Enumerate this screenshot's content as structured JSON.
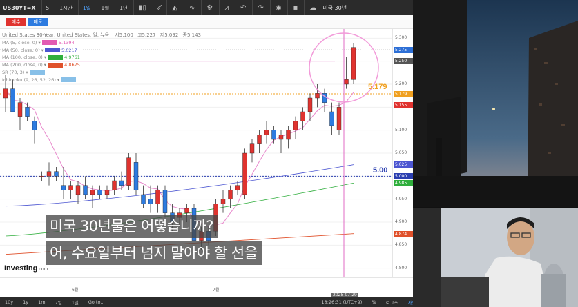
{
  "toolbar": {
    "symbol": "US30YT=X",
    "intervals": [
      "5",
      "1시간",
      "1일",
      "1월",
      "1년"
    ],
    "active_interval": "1일",
    "right_label": "미국 30년"
  },
  "trade": {
    "sell": "매수",
    "buy": "매도"
  },
  "chart_title": "United States 30-Year, United States, 일, 뉴욕",
  "ohlc": {
    "open": "시5.100",
    "high": "고5.227",
    "low": "저5.092",
    "close": "종5.143"
  },
  "indicators": [
    {
      "label": "MA (5, close, 0)",
      "value": "5.1394",
      "color": "#e25ab3"
    },
    {
      "label": "MA (50, close, 0)",
      "value": "5.0217",
      "color": "#4b55d1"
    },
    {
      "label": "MA (100, close, 0)",
      "value": "4.9761",
      "color": "#2fae3c"
    },
    {
      "label": "MA (200, close, 0)",
      "value": "4.8675",
      "color": "#e0502a"
    },
    {
      "label": "SR (70, 3)",
      "value": "",
      "color": "#88c0e8"
    },
    {
      "label": "Ichimoku (9, 26, 52, 26)",
      "value": "",
      "color": "#88c0e8"
    }
  ],
  "price_axis": [
    "5.300",
    "5.250",
    "5.200",
    "5.150",
    "5.100",
    "5.050",
    "5.000",
    "4.950",
    "4.900",
    "4.850",
    "4.800"
  ],
  "price_tags": [
    {
      "text": "5.275",
      "color": "#2d6fd6",
      "price": 5.275
    },
    {
      "text": "5.250",
      "color": "#555555",
      "price": 5.25
    },
    {
      "text": "5.179",
      "color": "#f0a020",
      "price": 5.179
    },
    {
      "text": "5.155",
      "color": "#e0332f",
      "price": 5.155
    },
    {
      "text": "5.025",
      "color": "#4b55d1",
      "price": 5.025
    },
    {
      "text": "5.000",
      "color": "#2b3fb0",
      "price": 5.0
    },
    {
      "text": "4.985",
      "color": "#2fae3c",
      "price": 4.985
    },
    {
      "text": "4.874",
      "color": "#e0502a",
      "price": 4.874
    }
  ],
  "annotations": {
    "orange_level": "5.179",
    "blue_level": "5.00"
  },
  "time_axis": {
    "month1": "6월",
    "month2": "7월",
    "cursor_date": "2025-07-29"
  },
  "bottombar": [
    "10y",
    "1y",
    "1m",
    "7일",
    "1일",
    "Go to...",
    "18:26:31 (UTC+9)",
    "%",
    "로그스",
    "자동"
  ],
  "logo": {
    "name": "Investing",
    "suffix": ".com"
  },
  "subtitles": {
    "line1": "미국 30년물은 어떻습니까?",
    "line2": "어, 수요일부터 넘지 말아야 할 선을"
  },
  "chart_data": {
    "type": "candlestick",
    "series": [
      {
        "o": 5.17,
        "h": 5.22,
        "l": 5.14,
        "c": 5.19
      },
      {
        "o": 5.19,
        "h": 5.21,
        "l": 5.14,
        "c": 5.14
      },
      {
        "o": 5.13,
        "h": 5.17,
        "l": 5.1,
        "c": 5.16
      },
      {
        "o": 5.15,
        "h": 5.16,
        "l": 5.12,
        "c": 5.13
      },
      {
        "o": 5.12,
        "h": 5.13,
        "l": 5.07,
        "c": 5.1
      },
      {
        "o": 5.0,
        "h": 5.01,
        "l": 4.99,
        "c": 5.0
      },
      {
        "o": 5.0,
        "h": 5.03,
        "l": 4.98,
        "c": 5.01
      },
      {
        "o": 5.01,
        "h": 5.02,
        "l": 4.99,
        "c": 5.0
      },
      {
        "o": 4.98,
        "h": 5.02,
        "l": 4.95,
        "c": 4.97
      },
      {
        "o": 4.97,
        "h": 4.99,
        "l": 4.95,
        "c": 4.98
      },
      {
        "o": 4.96,
        "h": 4.99,
        "l": 4.94,
        "c": 4.98
      },
      {
        "o": 4.98,
        "h": 5.0,
        "l": 4.95,
        "c": 4.96
      },
      {
        "o": 4.96,
        "h": 4.98,
        "l": 4.93,
        "c": 4.97
      },
      {
        "o": 4.97,
        "h": 4.98,
        "l": 4.95,
        "c": 4.96
      },
      {
        "o": 4.96,
        "h": 4.98,
        "l": 4.95,
        "c": 4.97
      },
      {
        "o": 4.97,
        "h": 5.0,
        "l": 4.96,
        "c": 4.99
      },
      {
        "o": 4.99,
        "h": 5.01,
        "l": 4.97,
        "c": 4.98
      },
      {
        "o": 4.98,
        "h": 5.05,
        "l": 4.97,
        "c": 5.04
      },
      {
        "o": 5.03,
        "h": 5.05,
        "l": 4.96,
        "c": 4.97
      },
      {
        "o": 4.96,
        "h": 4.98,
        "l": 4.93,
        "c": 4.94
      },
      {
        "o": 4.95,
        "h": 4.98,
        "l": 4.92,
        "c": 4.94
      },
      {
        "o": 4.94,
        "h": 4.98,
        "l": 4.92,
        "c": 4.97
      },
      {
        "o": 4.97,
        "h": 4.98,
        "l": 4.91,
        "c": 4.92
      },
      {
        "o": 4.92,
        "h": 4.94,
        "l": 4.88,
        "c": 4.9
      },
      {
        "o": 4.91,
        "h": 4.93,
        "l": 4.89,
        "c": 4.92
      },
      {
        "o": 4.92,
        "h": 4.94,
        "l": 4.9,
        "c": 4.93
      },
      {
        "o": 4.93,
        "h": 4.94,
        "l": 4.86,
        "c": 4.86
      },
      {
        "o": 4.86,
        "h": 4.89,
        "l": 4.84,
        "c": 4.88
      },
      {
        "o": 4.88,
        "h": 4.89,
        "l": 4.85,
        "c": 4.86
      },
      {
        "o": 4.88,
        "h": 4.95,
        "l": 4.87,
        "c": 4.94
      },
      {
        "o": 4.94,
        "h": 4.97,
        "l": 4.92,
        "c": 4.95
      },
      {
        "o": 4.95,
        "h": 4.98,
        "l": 4.93,
        "c": 4.97
      },
      {
        "o": 4.97,
        "h": 4.99,
        "l": 4.96,
        "c": 4.98
      },
      {
        "o": 4.96,
        "h": 5.06,
        "l": 4.95,
        "c": 5.05
      },
      {
        "o": 5.05,
        "h": 5.08,
        "l": 5.03,
        "c": 5.07
      },
      {
        "o": 5.07,
        "h": 5.1,
        "l": 5.05,
        "c": 5.09
      },
      {
        "o": 5.09,
        "h": 5.12,
        "l": 5.07,
        "c": 5.1
      },
      {
        "o": 5.1,
        "h": 5.11,
        "l": 5.07,
        "c": 5.08
      },
      {
        "o": 5.08,
        "h": 5.1,
        "l": 5.05,
        "c": 5.09
      },
      {
        "o": 5.08,
        "h": 5.11,
        "l": 5.06,
        "c": 5.1
      },
      {
        "o": 5.1,
        "h": 5.13,
        "l": 5.08,
        "c": 5.12
      },
      {
        "o": 5.12,
        "h": 5.15,
        "l": 5.1,
        "c": 5.14
      },
      {
        "o": 5.14,
        "h": 5.18,
        "l": 5.12,
        "c": 5.17
      },
      {
        "o": 5.17,
        "h": 5.2,
        "l": 5.15,
        "c": 5.18
      },
      {
        "o": 5.18,
        "h": 5.19,
        "l": 5.14,
        "c": 5.16
      },
      {
        "o": 5.14,
        "h": 5.16,
        "l": 5.09,
        "c": 5.11
      },
      {
        "o": 5.1,
        "h": 5.16,
        "l": 5.09,
        "c": 5.15
      },
      {
        "o": 5.2,
        "h": 5.26,
        "l": 5.19,
        "c": 5.21
      },
      {
        "o": 5.21,
        "h": 5.29,
        "l": 5.2,
        "c": 5.28
      }
    ],
    "ylim": [
      4.78,
      5.32
    ]
  }
}
